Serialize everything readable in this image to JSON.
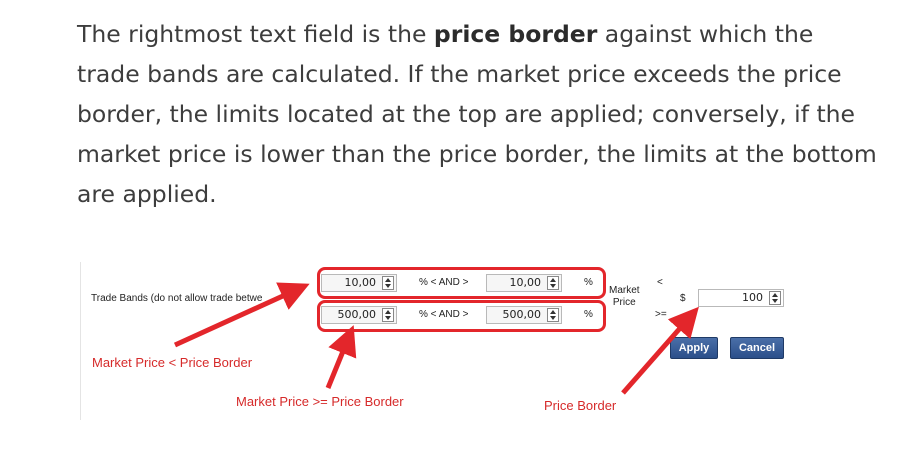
{
  "paragraph": {
    "before": "The rightmost text field is the ",
    "bold": "price border",
    "after": " against which the trade bands are calculated. If the market price exceeds the price border, the limits located at the top are applied; conversely, if the market price is lower than the price border, the limits at the bottom are applied."
  },
  "screenshot": {
    "trade_bands_label": "Trade Bands (do not allow trade betwe",
    "row_top": {
      "left_value": "10,00",
      "operator": "% < AND >",
      "right_value": "10,00",
      "percent": "%"
    },
    "row_bottom": {
      "left_value": "500,00",
      "operator": "% < AND >",
      "right_value": "500,00",
      "percent": "%"
    },
    "market_price_label": "Market\nPrice",
    "lt_symbol": "<",
    "gte_symbol": ">=",
    "currency": "$",
    "price_border_value": "100",
    "apply_label": "Apply",
    "cancel_label": "Cancel"
  },
  "annotations": {
    "market_lt_border": "Market Price < Price Border",
    "market_gte_border": "Market Price >= Price Border",
    "price_border": "Price Border"
  },
  "colors": {
    "annotation_red": "#e3262b",
    "button_blue": "#2b4f8a"
  }
}
